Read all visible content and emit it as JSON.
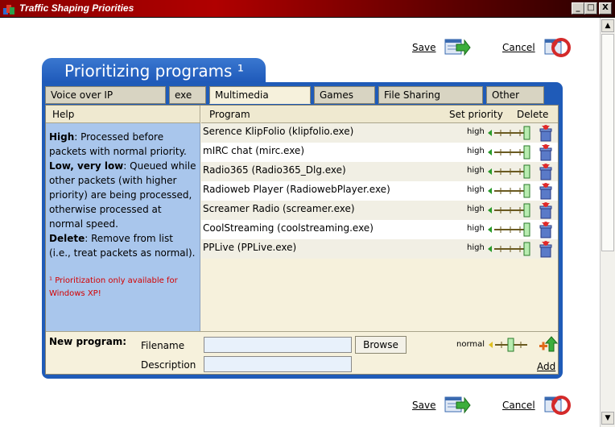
{
  "window": {
    "title": "Traffic Shaping Priorities",
    "buttons": {
      "minimize": "_",
      "maximize": "□",
      "close": "X"
    }
  },
  "actions": {
    "save": "Save",
    "cancel": "Cancel"
  },
  "panel": {
    "title": "Prioritizing programs ¹"
  },
  "tabs": [
    {
      "label": "Voice over IP",
      "active": false
    },
    {
      "label": "exe",
      "active": false
    },
    {
      "label": "Multimedia",
      "active": true
    },
    {
      "label": "Games",
      "active": false
    },
    {
      "label": "File Sharing",
      "active": false
    },
    {
      "label": "Other",
      "active": false
    }
  ],
  "help": {
    "header": "Help",
    "high_term": "High",
    "high_text": ": Processed before packets with normal priority.",
    "low_term": "Low, very low",
    "low_text": ": Queued while other packets (with higher priority) are being processed, otherwise processed at normal speed.",
    "delete_term": "Delete",
    "delete_text": ": Remove from list (i.e., treat packets as normal).",
    "footnote": "¹ Prioritization only available for Windows XP!"
  },
  "table": {
    "headers": {
      "program": "Program",
      "set_priority": "Set priority",
      "delete": "Delete"
    },
    "rows": [
      {
        "program": "Serence KlipFolio (klipfolio.exe)",
        "priority": "high"
      },
      {
        "program": "mIRC chat (mirc.exe)",
        "priority": "high"
      },
      {
        "program": "Radio365 (Radio365_Dlg.exe)",
        "priority": "high"
      },
      {
        "program": "Radioweb Player (RadiowebPlayer.exe)",
        "priority": "high"
      },
      {
        "program": "Screamer Radio (screamer.exe)",
        "priority": "high"
      },
      {
        "program": "CoolStreaming (coolstreaming.exe)",
        "priority": "high"
      },
      {
        "program": "PPLive (PPLive.exe)",
        "priority": "high"
      }
    ]
  },
  "new_program": {
    "label": "New program:",
    "filename_label": "Filename",
    "description_label": "Description",
    "filename_value": "",
    "description_value": "",
    "browse": "Browse",
    "priority": "normal",
    "add": "Add"
  },
  "colors": {
    "panel_blue": "#1f5bb8",
    "help_bg": "#a9c6ec",
    "content_bg": "#f6f1dc",
    "footnote_red": "#d40000",
    "slider_green": "#2a9a2a"
  }
}
